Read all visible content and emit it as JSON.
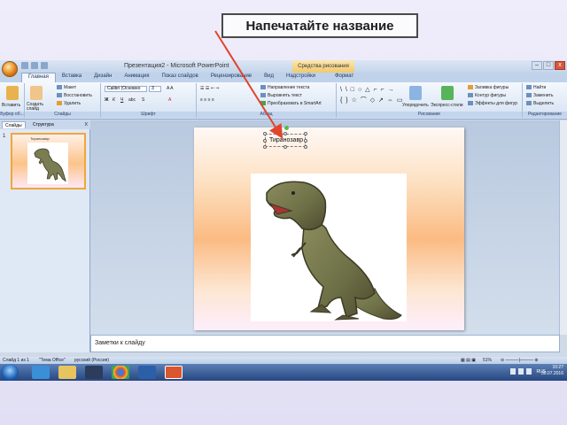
{
  "callout": {
    "text": "Напечатайте название"
  },
  "window": {
    "doc_title": "Презентация2 - Microsoft PowerPoint",
    "contextual_tab": "Средства рисования",
    "min": "–",
    "max": "□",
    "close": "x"
  },
  "ribbon_tabs": [
    "Главная",
    "Вставка",
    "Дизайн",
    "Анимация",
    "Показ слайдов",
    "Рецензирование",
    "Вид",
    "Надстройки",
    "Формат"
  ],
  "ribbon": {
    "clipboard": {
      "label": "Буфер об...",
      "paste": "Вставить"
    },
    "slides": {
      "label": "Слайды",
      "new_slide": "Создать слайд",
      "layout": "Макет",
      "reset": "Восстановить",
      "delete": "Удалить"
    },
    "font": {
      "label": "Шрифт",
      "font_name": "Calibri (Основно",
      "font_size": "3"
    },
    "paragraph": {
      "label": "Абзац",
      "text_direction": "Направление текста",
      "align_text": "Выровнять текст",
      "smartart": "Преобразовать в SmartArt"
    },
    "drawing": {
      "label": "Рисование",
      "arrange": "Упорядочить",
      "quick_styles": "Экспресс-стили",
      "fill": "Заливка фигуры",
      "outline": "Контур фигуры",
      "effects": "Эффекты для фигур"
    },
    "editing": {
      "label": "Редактирование",
      "find": "Найти",
      "replace": "Заменить",
      "select": "Выделить"
    }
  },
  "pane": {
    "tab_slides": "Слайды",
    "tab_outline": "Структура",
    "close": "x",
    "slide_number": "1",
    "thumb_title": "Тиранозавр"
  },
  "slide": {
    "title_text": "Тиранозавр"
  },
  "notes": {
    "placeholder": "Заметки к слайду"
  },
  "status": {
    "slide_info": "Слайд 1 из 1",
    "theme": "\"Тема Office\"",
    "language": "русский (Россия)",
    "zoom": "51%"
  },
  "tray": {
    "lang": "RUS",
    "time": "10:27",
    "date": "30.07.2016"
  },
  "colors": {
    "accent": "#e0462e",
    "slide_orange": "#fbbb83",
    "ribbon_blue": "#d4e2f3"
  }
}
